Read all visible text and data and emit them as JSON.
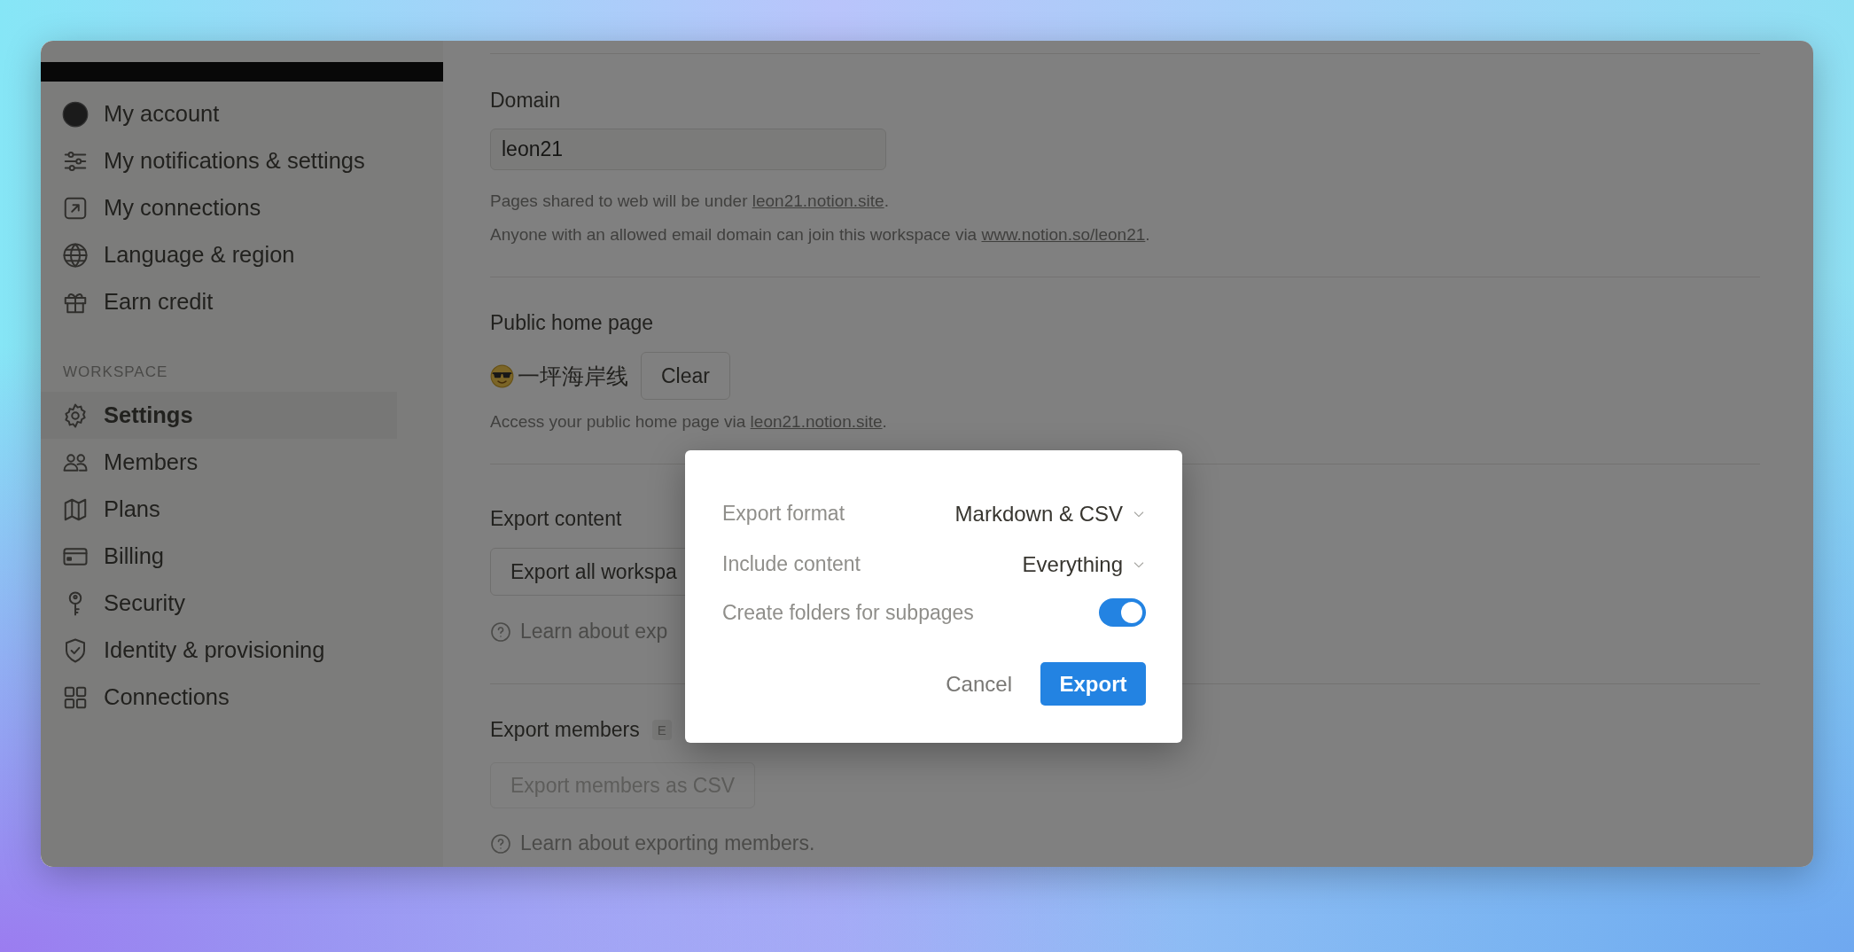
{
  "sidebar": {
    "account_items": [
      {
        "label": "My account",
        "selected": false
      },
      {
        "label": "My notifications & settings",
        "selected": false
      },
      {
        "label": "My connections",
        "selected": false
      },
      {
        "label": "Language & region",
        "selected": false
      },
      {
        "label": "Earn credit",
        "selected": false
      }
    ],
    "section_label": "WORKSPACE",
    "workspace_items": [
      {
        "label": "Settings",
        "selected": true
      },
      {
        "label": "Members",
        "selected": false
      },
      {
        "label": "Plans",
        "selected": false
      },
      {
        "label": "Billing",
        "selected": false
      },
      {
        "label": "Security",
        "selected": false
      },
      {
        "label": "Identity & provisioning",
        "selected": false
      },
      {
        "label": "Connections",
        "selected": false
      }
    ]
  },
  "domain": {
    "label": "Domain",
    "value": "leon21",
    "notes": [
      {
        "text": "Pages shared to web will be under ",
        "link": "leon21.notion.site",
        "end": "."
      },
      {
        "text": "Anyone with an allowed email domain can join this workspace via ",
        "link": "www.notion.so/leon21",
        "end": "."
      }
    ]
  },
  "public_home_page": {
    "label": "Public home page",
    "page_title": "一坪海岸线",
    "clear_button": "Clear",
    "note": {
      "text": "Access your public home page via ",
      "link": "leon21.notion.site",
      "end": "."
    }
  },
  "export_content": {
    "label": "Export content",
    "button": "Export all workspa",
    "help": "Learn about exp"
  },
  "export_members": {
    "label": "Export members",
    "badge": "E",
    "button": "Export members as CSV",
    "button_disabled": true,
    "help": "Learn about exporting members."
  },
  "dialog": {
    "rows": [
      {
        "kind": "select",
        "label": "Export format",
        "value": "Markdown & CSV"
      },
      {
        "kind": "select",
        "label": "Include content",
        "value": "Everything"
      },
      {
        "kind": "toggle",
        "label": "Create folders for subpages",
        "on": true
      }
    ],
    "buttons": [
      {
        "kind": "secondary",
        "label": "Cancel"
      },
      {
        "kind": "primary",
        "label": "Export"
      }
    ]
  }
}
